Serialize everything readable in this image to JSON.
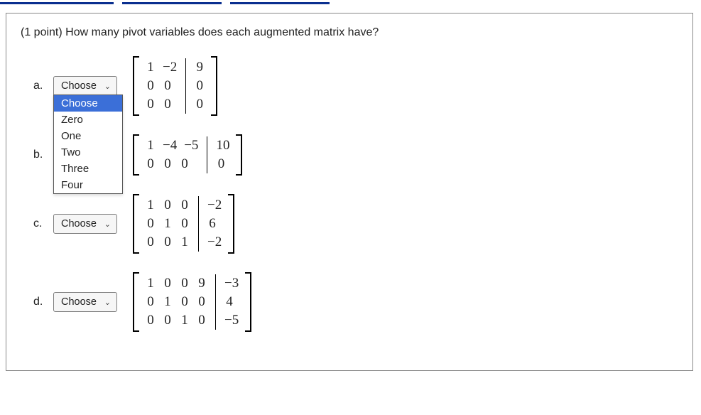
{
  "question": "(1 point) How many pivot variables does each augmented matrix have?",
  "select_placeholder": "Choose",
  "dropdown_options": [
    "Choose",
    "Zero",
    "One",
    "Two",
    "Three",
    "Four"
  ],
  "parts": {
    "a": {
      "label": "a.",
      "show_select": true,
      "show_dropdown": true,
      "matrix_left": [
        [
          "1",
          "−2"
        ],
        [
          "0",
          "0"
        ],
        [
          "0",
          "0"
        ]
      ],
      "matrix_right": [
        [
          "9"
        ],
        [
          "0"
        ],
        [
          "0"
        ]
      ]
    },
    "b": {
      "label": "b.",
      "show_select": false,
      "matrix_left": [
        [
          "1",
          "−4",
          "−5"
        ],
        [
          "0",
          "0",
          "0"
        ]
      ],
      "matrix_right": [
        [
          "10"
        ],
        [
          "0"
        ]
      ]
    },
    "c": {
      "label": "c.",
      "show_select": true,
      "matrix_left": [
        [
          "1",
          "0",
          "0"
        ],
        [
          "0",
          "1",
          "0"
        ],
        [
          "0",
          "0",
          "1"
        ]
      ],
      "matrix_right": [
        [
          "−2"
        ],
        [
          "6"
        ],
        [
          "−2"
        ]
      ]
    },
    "d": {
      "label": "d.",
      "show_select": true,
      "matrix_left": [
        [
          "1",
          "0",
          "0",
          "9"
        ],
        [
          "0",
          "1",
          "0",
          "0"
        ],
        [
          "0",
          "0",
          "1",
          "0"
        ]
      ],
      "matrix_right": [
        [
          "−3"
        ],
        [
          "4"
        ],
        [
          "−5"
        ]
      ]
    }
  }
}
